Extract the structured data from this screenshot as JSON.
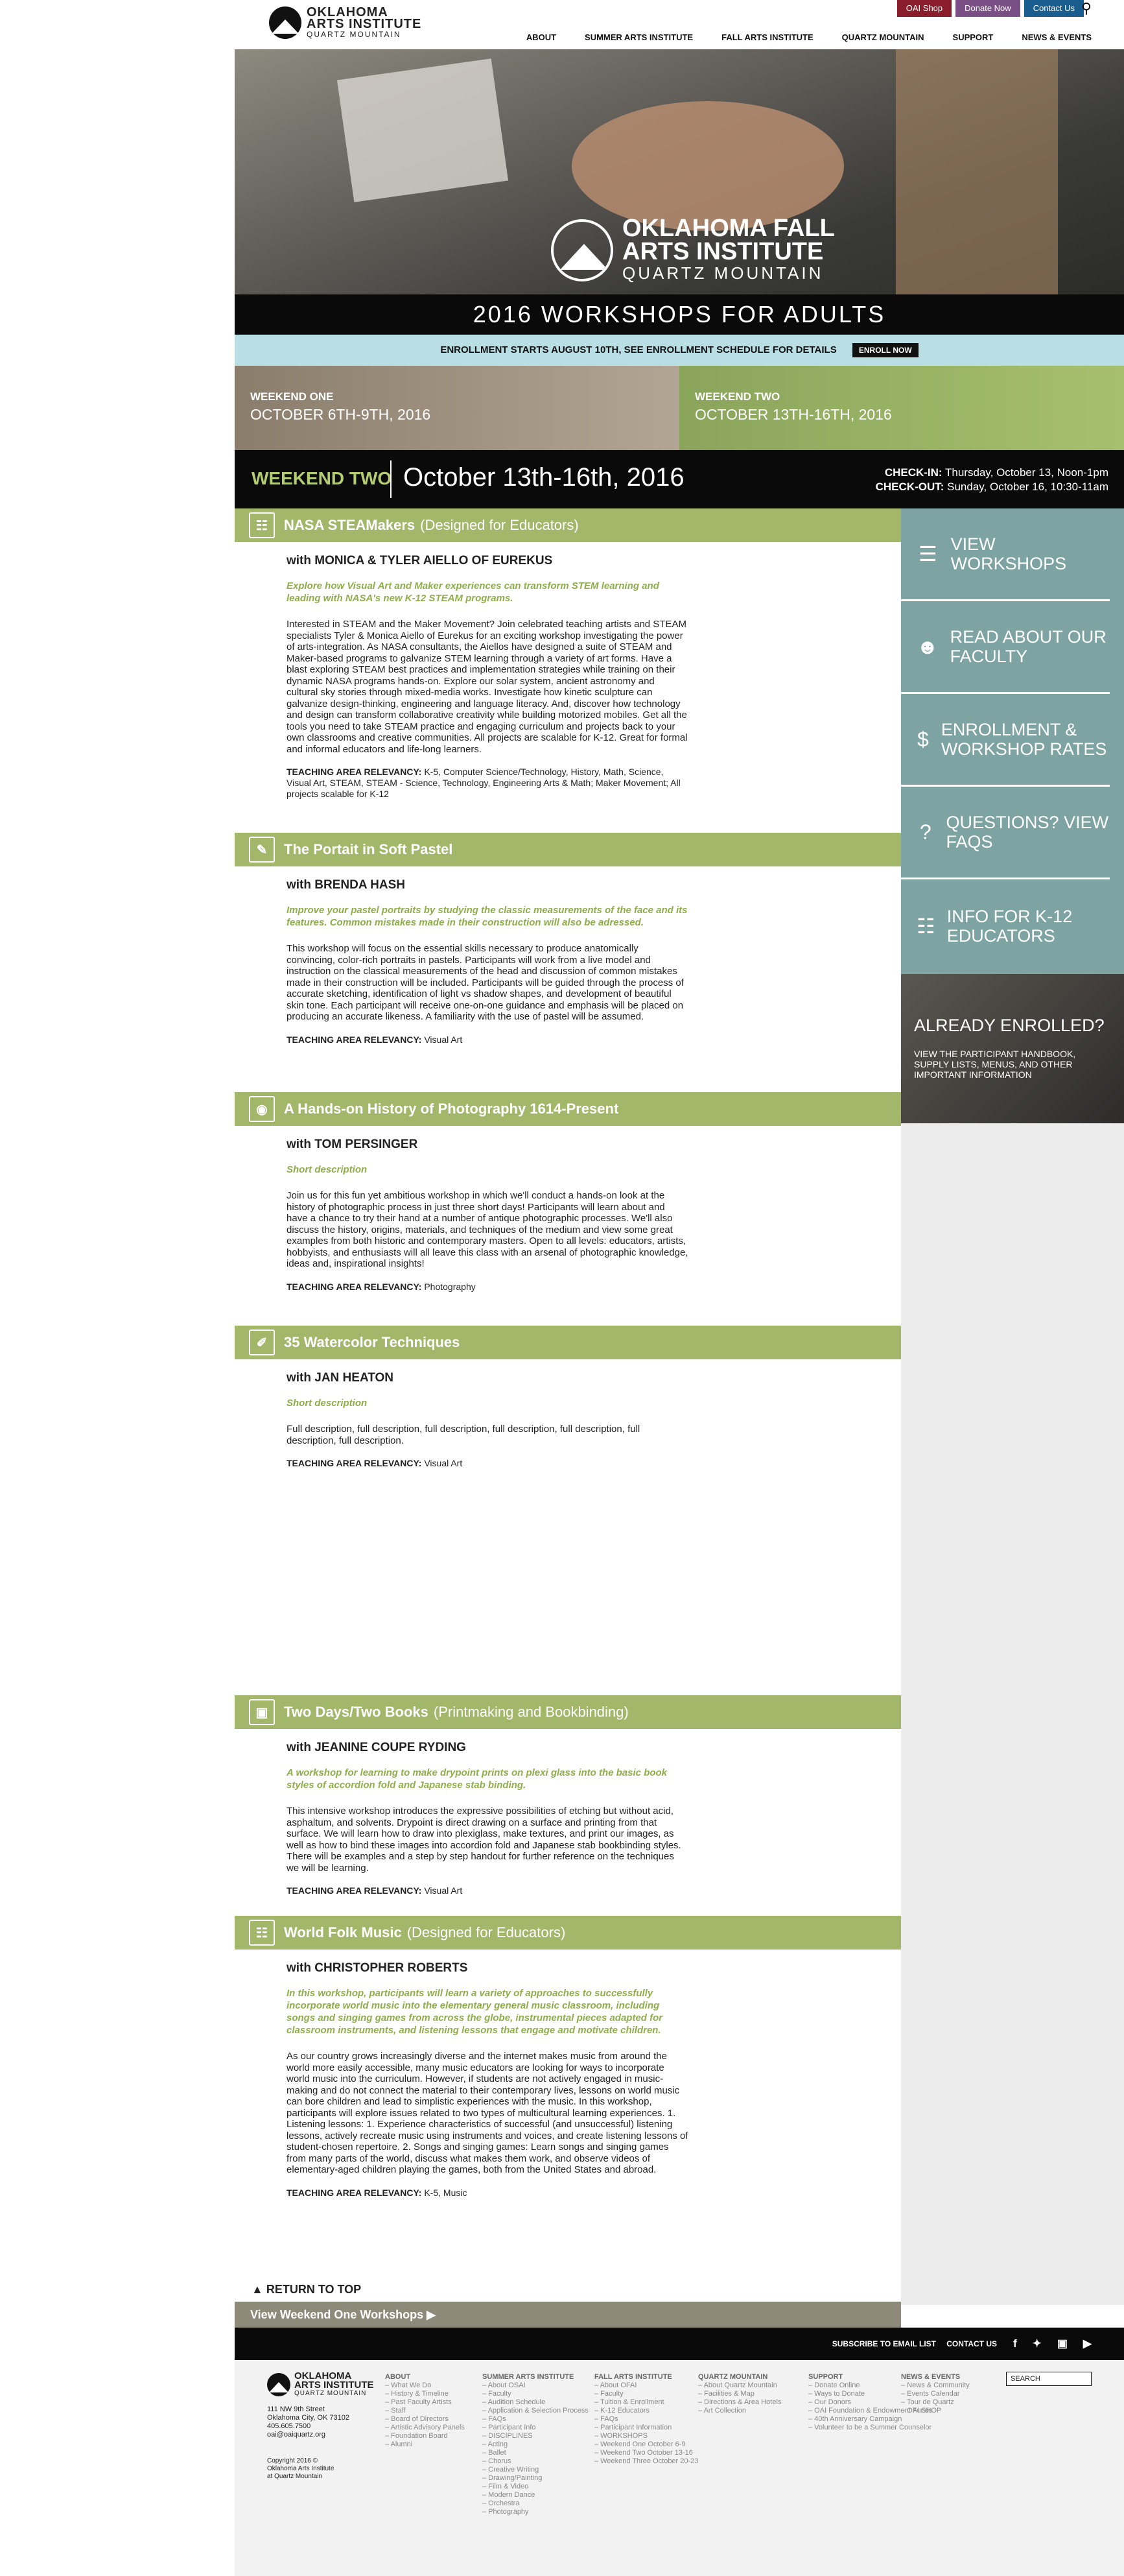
{
  "util": {
    "shop": "OAI Shop",
    "donate": "Donate Now",
    "contact": "Contact Us"
  },
  "logo": {
    "line1": "OKLAHOMA",
    "line2": "ARTS INSTITUTE",
    "line3": "QUARTZ MOUNTAIN"
  },
  "nav": [
    "ABOUT",
    "SUMMER ARTS INSTITUTE",
    "FALL ARTS INSTITUTE",
    "QUARTZ MOUNTAIN",
    "SUPPORT",
    "NEWS & EVENTS"
  ],
  "hero": {
    "line1": "OKLAHOMA FALL",
    "line2": "ARTS INSTITUTE",
    "line3": "QUARTZ MOUNTAIN"
  },
  "band_title": "2016 WORKSHOPS FOR ADULTS",
  "enroll": {
    "text": "ENROLLMENT STARTS AUGUST 10TH, SEE ENROLLMENT SCHEDULE FOR DETAILS",
    "button": "ENROLL NOW"
  },
  "weekends": [
    {
      "label": "WEEKEND ONE",
      "dates": "OCTOBER 6TH-9TH, 2016"
    },
    {
      "label": "WEEKEND TWO",
      "dates": "OCTOBER 13TH-16TH, 2016"
    }
  ],
  "current": {
    "label": "WEEKEND TWO",
    "dates": "October 13th-16th, 2016",
    "checkin_label": "CHECK-IN:",
    "checkin": "Thursday, October 13, Noon-1pm",
    "checkout_label": "CHECK-OUT:",
    "checkout": "Sunday, October 16, 10:30-11am"
  },
  "workshops": [
    {
      "title": "NASA STEAMakers",
      "sub": "(Designed for Educators)",
      "instructor": "with MONICA & TYLER AIELLO OF EUREKUS",
      "lead": "Explore how Visual Art and Maker experiences can transform STEM learning and leading with NASA's new K-12 STEAM programs.",
      "desc": "Interested in STEAM and the Maker Movement? Join celebrated teaching artists and STEAM specialists Tyler & Monica Aiello of Eurekus for an exciting workshop investigating the power of arts-integration. As NASA consultants, the Aiellos have designed a suite of STEAM and Maker-based programs to galvanize STEM learning through a variety of art forms. Have a blast exploring STEAM best practices and implementation strategies while training on their dynamic NASA programs hands-on. Explore our solar system, ancient astronomy and cultural sky stories through mixed-media works. Investigate how kinetic sculpture can galvanize design-thinking, engineering and language literacy. And, discover how technology and design can transform collaborative creativity while building motorized mobiles. Get all the tools you need to take STEAM practice and engaging curriculum and projects back to your own classrooms and creative communities. All projects are scalable for K-12. Great for formal and informal educators and life-long learners.",
      "rel_label": "TEACHING AREA RELEVANCY:",
      "rel": "K-5, Computer Science/Technology, History, Math, Science, Visual Art, STEAM, STEAM - Science, Technology, Engineering Arts & Math; Maker Movement; All projects scalable for K-12",
      "icon": "network-icon"
    },
    {
      "title": "The Portait in Soft Pastel",
      "sub": "",
      "instructor": "with BRENDA HASH",
      "lead": "Improve your pastel portraits by studying the classic measurements of the face and its features. Common mistakes made in their construction will also be adressed.",
      "desc": "This workshop will focus on the essential skills necessary to produce anatomically convincing, color-rich portraits in pastels. Participants will work from a live model and instruction on the classical measurements of the head and discussion of common mistakes made in their construction will be included. Participants will be guided through the process of accurate sketching, identification of light vs shadow shapes, and development of beautiful skin tone. Each participant will receive one-on-one guidance and emphasis will be placed on producing an accurate likeness. A familiarity with the use of pastel will be assumed.",
      "rel_label": "TEACHING AREA RELEVANCY:",
      "rel": "Visual Art",
      "icon": "pencil-icon"
    },
    {
      "title": "A Hands-on History of Photography 1614-Present",
      "sub": "",
      "instructor": "with TOM PERSINGER",
      "lead": "Short description",
      "desc": "Join us for this fun yet ambitious workshop in which we'll conduct a hands-on look at the history of photographic process in just three short days! Participants will learn about and have a chance to try their hand at a number of antique photographic processes. We'll also discuss the history, origins, materials, and techniques of the medium and view some great examples from both historic and contemporary masters. Open to all levels: educators, artists, hobbyists, and enthusiasts will all leave this class with an arsenal of photographic knowledge, ideas and, inspirational insights!",
      "rel_label": "TEACHING AREA RELEVANCY:",
      "rel": "Photography",
      "icon": "camera-icon"
    },
    {
      "title": "35 Watercolor Techniques",
      "sub": "",
      "instructor": "with JAN HEATON",
      "lead": "Short description",
      "desc": "Full description, full description, full description, full description, full description, full description, full description.",
      "rel_label": "TEACHING AREA RELEVANCY:",
      "rel": "Visual Art",
      "icon": "paintbrush-icon"
    },
    {
      "title": "Two Days/Two Books",
      "sub": "(Printmaking and Bookbinding)",
      "instructor": "with JEANINE COUPE RYDING",
      "lead": "A workshop for learning to make drypoint prints on plexi glass into the basic book styles of accordion fold and Japanese stab binding.",
      "desc": "This intensive workshop introduces the expressive possibilities of etching but without acid, asphaltum, and solvents. Drypoint is direct drawing on a surface and printing from that surface. We will learn how to draw into plexiglass, make textures, and print our images, as well as how to bind these images into accordion fold and Japanese stab bookbinding styles. There will be examples and a step by step handout for further reference on the techniques we will be learning.",
      "rel_label": "TEACHING AREA RELEVANCY:",
      "rel": "Visual Art",
      "icon": "image-icon"
    },
    {
      "title": "World Folk Music",
      "sub": "(Designed for Educators)",
      "instructor": "with CHRISTOPHER ROBERTS",
      "lead": "In this workshop, participants will learn a variety of approaches to successfully incorporate world music into the elementary general music classroom, including songs and singing games from across the globe, instrumental pieces adapted for classroom instruments, and listening lessons that engage and motivate children.",
      "desc": "As our country grows increasingly diverse and the internet makes music from around the world more easily accessible, many music educators are looking for ways to incorporate world music into the curriculum. However, if students are not actively engaged in music-making and do not connect the material to their contemporary lives, lessons on world music can bore children and lead to simplistic experiences with the music. In this workshop, participants will explore issues related to two types of multicultural learning experiences. 1. Listening lessons: 1. Experience characteristics of successful (and unsuccessful) listening lessons, actively recreate music using instruments and voices, and create listening lessons of student-chosen repertoire. 2. Songs and singing games: Learn songs and singing games from many parts of the world, discuss what makes them work, and observe videos of elementary-aged children playing the games, both from the United States and abroad.",
      "rel_label": "TEACHING AREA RELEVANCY:",
      "rel": "K-5, Music",
      "icon": "network-icon"
    }
  ],
  "sidebar": {
    "items": [
      {
        "label": "VIEW WORKSHOPS",
        "icon": "list-icon"
      },
      {
        "label": "READ ABOUT OUR FACULTY",
        "icon": "people-icon"
      },
      {
        "label": "ENROLLMENT & WORKSHOP RATES",
        "icon": "dollar-icon"
      },
      {
        "label": "QUESTIONS? VIEW FAQS",
        "icon": "question-icon"
      },
      {
        "label": "INFO FOR K-12 EDUCATORS",
        "icon": "network-icon"
      }
    ],
    "already_title": "ALREADY ENROLLED?",
    "already_text": "VIEW THE PARTICIPANT HANDBOOK, SUPPLY LISTS, MENUS, AND OTHER IMPORTANT INFORMATION"
  },
  "return_top": "RETURN TO TOP",
  "other_weekend": "View Weekend One Workshops",
  "footer_bar": {
    "email": "SUBSCRIBE TO EMAIL LIST",
    "contact": "CONTACT US"
  },
  "footer": {
    "address": [
      "111 NW 9th Street",
      "Oklahoma City, OK 73102",
      "405.605.7500",
      "oai@oaiquartz.org"
    ],
    "copyright": [
      "Copyright 2016 ©",
      "Oklahoma Arts Institute",
      "at Quartz Mountain"
    ],
    "search_placeholder": "SEARCH",
    "cols": [
      {
        "h": "ABOUT",
        "items": [
          "What We Do",
          "History & Timeline",
          "Past Faculty Artists",
          "Staff",
          "Board of Directors",
          "Artistic Advisory Panels",
          "Foundation Board",
          "Alumni"
        ]
      },
      {
        "h": "SUMMER ARTS INSTITUTE",
        "items": [
          "About OSAI",
          "Faculty",
          "Audition Schedule",
          "Application & Selection Process",
          "FAQs",
          "Participant Info",
          "DISCIPLINES",
          "Acting",
          "Ballet",
          "Chorus",
          "Creative Writing",
          "Drawing/Painting",
          "Film & Video",
          "Modern Dance",
          "Orchestra",
          "Photography"
        ]
      },
      {
        "h": "FALL ARTS INSTITUTE",
        "items": [
          "About OFAI",
          "Faculty",
          "Tuition & Enrollment",
          "K-12 Educators",
          "FAQs",
          "Participant Information",
          "WORKSHOPS",
          "Weekend One October 6-9",
          "Weekend Two October 13-16",
          "Weekend Three October 20-23"
        ]
      },
      {
        "h": "QUARTZ MOUNTAIN",
        "items": [
          "About Quartz Mountain",
          "Facilities & Map",
          "Directions & Area Hotels",
          "Art Collection"
        ]
      },
      {
        "h": "SUPPORT",
        "items": [
          "Donate Online",
          "Ways to Donate",
          "Our Donors",
          "OAI Foundation & Endowment Funds",
          "40th Anniversary Campaign",
          "Volunteer to be a Summer Counselor"
        ]
      },
      {
        "h": "NEWS & EVENTS",
        "items": [
          "News & Community",
          "Events Calendar",
          "Tour de Quartz",
          "OAI SHOP"
        ]
      }
    ]
  }
}
